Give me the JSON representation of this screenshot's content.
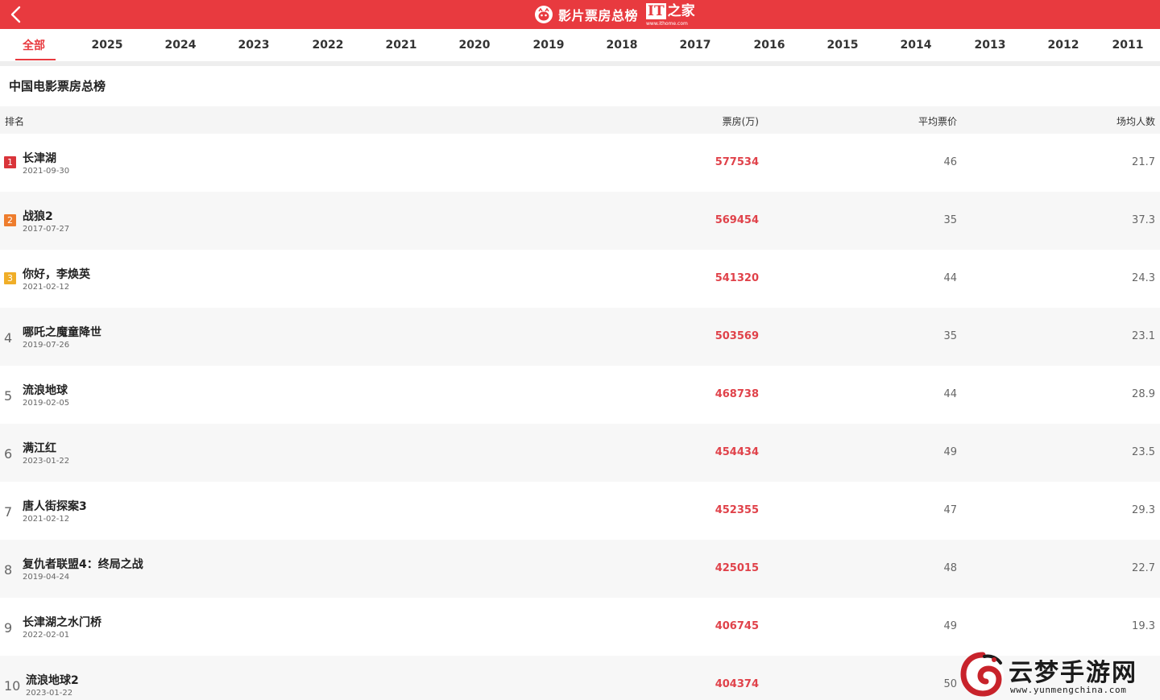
{
  "header": {
    "title": "影片票房总榜",
    "it_logo_text": "IT",
    "it_logo_cn": "之家",
    "it_logo_url": "www.ithome.com",
    "color": "#e83a3f"
  },
  "tabs": [
    "全部",
    "2025",
    "2024",
    "2023",
    "2022",
    "2021",
    "2020",
    "2019",
    "2018",
    "2017",
    "2016",
    "2015",
    "2014",
    "2013",
    "2012",
    "2011"
  ],
  "active_tab": "全部",
  "list_title": "中国电影票房总榜",
  "columns": {
    "rank": "排名",
    "box_office": "票房(万)",
    "avg_price": "平均票价",
    "avg_people": "场均人数"
  },
  "rows": [
    {
      "rank": "1",
      "name": "长津湖",
      "date": "2021-09-30",
      "box": "577534",
      "price": "46",
      "people": "21.7"
    },
    {
      "rank": "2",
      "name": "战狼2",
      "date": "2017-07-27",
      "box": "569454",
      "price": "35",
      "people": "37.3"
    },
    {
      "rank": "3",
      "name": "你好，李焕英",
      "date": "2021-02-12",
      "box": "541320",
      "price": "44",
      "people": "24.3"
    },
    {
      "rank": "4",
      "name": "哪吒之魔童降世",
      "date": "2019-07-26",
      "box": "503569",
      "price": "35",
      "people": "23.1"
    },
    {
      "rank": "5",
      "name": "流浪地球",
      "date": "2019-02-05",
      "box": "468738",
      "price": "44",
      "people": "28.9"
    },
    {
      "rank": "6",
      "name": "满江红",
      "date": "2023-01-22",
      "box": "454434",
      "price": "49",
      "people": "23.5"
    },
    {
      "rank": "7",
      "name": "唐人街探案3",
      "date": "2021-02-12",
      "box": "452355",
      "price": "47",
      "people": "29.3"
    },
    {
      "rank": "8",
      "name": "复仇者联盟4：终局之战",
      "date": "2019-04-24",
      "box": "425015",
      "price": "48",
      "people": "22.7"
    },
    {
      "rank": "9",
      "name": "长津湖之水门桥",
      "date": "2022-02-01",
      "box": "406745",
      "price": "49",
      "people": "19.3"
    },
    {
      "rank": "10",
      "name": "流浪地球2",
      "date": "2023-01-22",
      "box": "404374",
      "price": "50",
      "people": ""
    }
  ],
  "watermark": {
    "text": "云梦手游网",
    "url": "www.yunmengchina.com"
  }
}
